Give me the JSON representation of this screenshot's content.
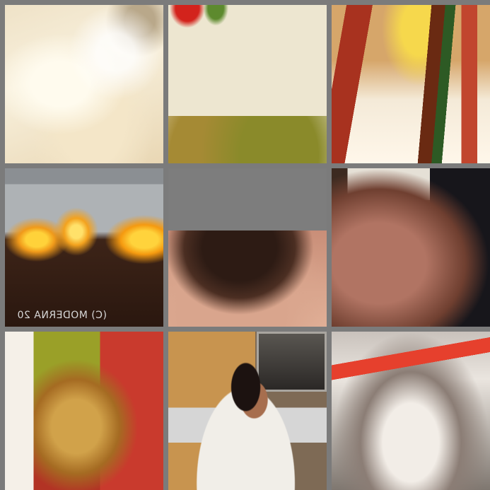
{
  "grid": {
    "background_color": "#7b7b7b",
    "tiles": [
      {
        "id": "potato",
        "subject": "mashed-potatoes"
      },
      {
        "id": "plate",
        "subject": "plate-with-sauce"
      },
      {
        "id": "condiments",
        "subject": "condiment-bottles"
      },
      {
        "id": "fire",
        "subject": "fire-pit",
        "watermark": "(C) MODERNA 20"
      },
      {
        "id": "hair",
        "subject": "head-of-hair"
      },
      {
        "id": "shoulder",
        "subject": "shoulder"
      },
      {
        "id": "woman",
        "subject": "woman-long-hair"
      },
      {
        "id": "kitchen",
        "subject": "woman-in-kitchen"
      },
      {
        "id": "jar",
        "subject": "glass-jar-red-band"
      }
    ]
  }
}
